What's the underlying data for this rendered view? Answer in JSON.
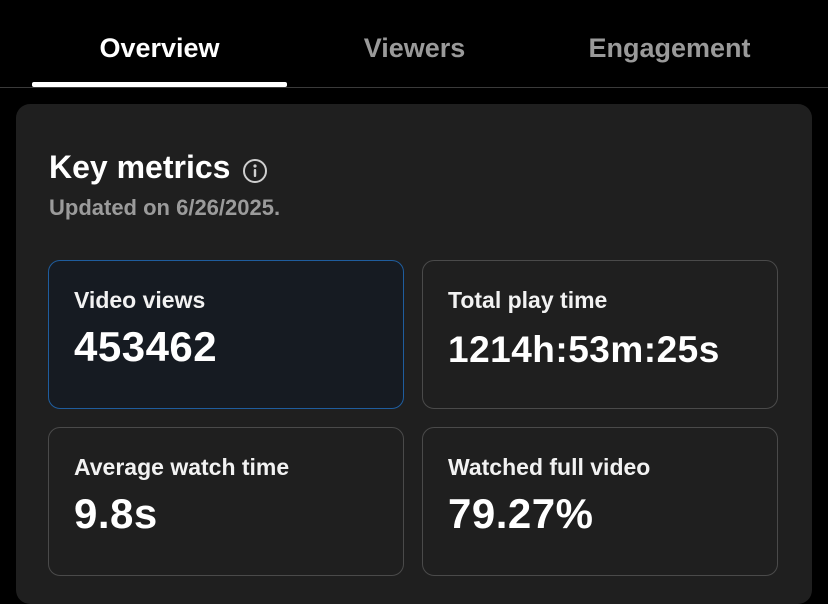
{
  "tabs": [
    {
      "label": "Overview",
      "active": true
    },
    {
      "label": "Viewers",
      "active": false
    },
    {
      "label": "Engagement",
      "active": false
    }
  ],
  "key_metrics": {
    "title": "Key metrics",
    "info_icon": "info-circle-icon",
    "updated": "Updated on 6/26/2025.",
    "cards": [
      {
        "label": "Video views",
        "value": "453462",
        "selected": true
      },
      {
        "label": "Total play time",
        "value": "1214h:53m:25s",
        "selected": false
      },
      {
        "label": "Average watch time",
        "value": "9.8s",
        "selected": false
      },
      {
        "label": "Watched full video",
        "value": "79.27%",
        "selected": false
      }
    ]
  },
  "colors": {
    "background": "#000000",
    "card": "#1f1f1f",
    "selected_border": "#1f5d9e",
    "inactive_tab": "#9a9a9a"
  }
}
